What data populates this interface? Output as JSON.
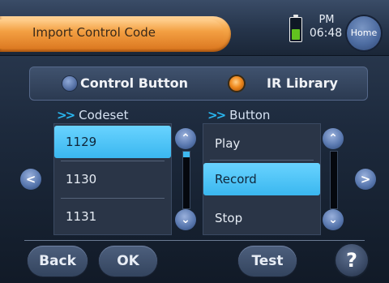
{
  "header": {
    "title": "Import Control Code",
    "clock_ampm": "PM",
    "clock_time": "06:48",
    "home_label": "Home",
    "battery_level": 0.5
  },
  "mode": {
    "options": [
      {
        "label": "Control Button",
        "selected": false
      },
      {
        "label": "IR Library",
        "selected": true
      }
    ]
  },
  "codeset": {
    "header": "Codeset",
    "items": [
      "1129",
      "1130",
      "1131"
    ],
    "selected_index": 0,
    "scroll_position": 0.1
  },
  "button": {
    "header": "Button",
    "items": [
      "Play",
      "Record",
      "Stop"
    ],
    "selected_index": 1
  },
  "footer": {
    "back_label": "Back",
    "ok_label": "OK",
    "test_label": "Test",
    "help_label": "?"
  },
  "colors": {
    "accent_orange": "#f3a043",
    "selection_blue": "#3ab7ef",
    "battery_green": "#62c21f"
  }
}
